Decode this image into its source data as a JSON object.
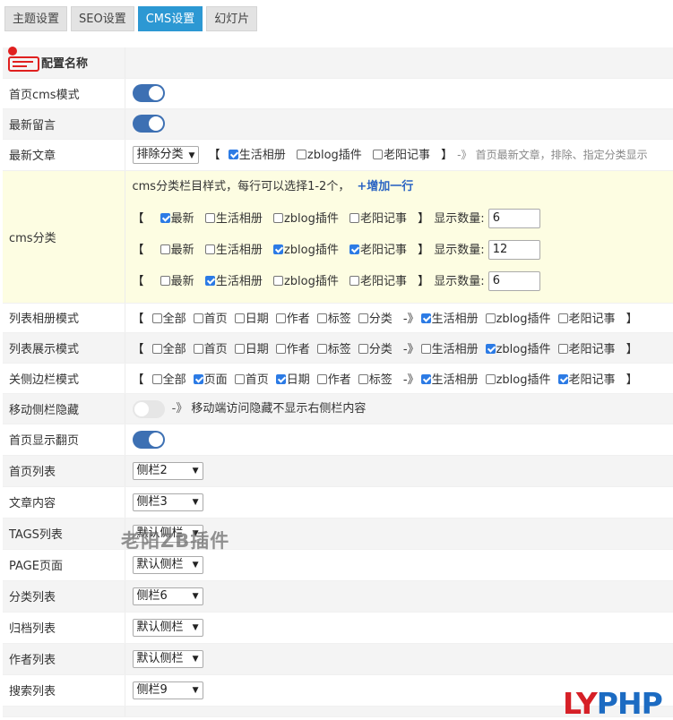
{
  "tabs": [
    {
      "label": "主题设置",
      "active": false
    },
    {
      "label": "SEO设置",
      "active": false
    },
    {
      "label": "CMS设置",
      "active": true
    },
    {
      "label": "幻灯片",
      "active": false
    }
  ],
  "header": {
    "label": "配置名称"
  },
  "rows": {
    "home_cms": {
      "label": "首页cms模式",
      "on": true
    },
    "latest_comments": {
      "label": "最新留言",
      "on": true
    },
    "latest_posts": {
      "label": "最新文章",
      "select": "排除分类",
      "options": [
        {
          "label": "生活相册",
          "checked": true
        },
        {
          "label": "zblog插件",
          "checked": false
        },
        {
          "label": "老阳记事",
          "checked": false
        }
      ],
      "hint": "首页最新文章，排除、指定分类显示"
    },
    "cms_category": {
      "label": "cms分类",
      "intro": "cms分类栏目样式，每行可以选择1-2个，",
      "add_row": "+增加一行",
      "count_label": "显示数量:",
      "lines": [
        {
          "options": [
            {
              "label": "最新",
              "checked": true
            },
            {
              "label": "生活相册",
              "checked": false
            },
            {
              "label": "zblog插件",
              "checked": false
            },
            {
              "label": "老阳记事",
              "checked": false
            }
          ],
          "count": "6"
        },
        {
          "options": [
            {
              "label": "最新",
              "checked": false
            },
            {
              "label": "生活相册",
              "checked": false
            },
            {
              "label": "zblog插件",
              "checked": true
            },
            {
              "label": "老阳记事",
              "checked": true
            }
          ],
          "count": "12"
        },
        {
          "options": [
            {
              "label": "最新",
              "checked": false
            },
            {
              "label": "生活相册",
              "checked": true
            },
            {
              "label": "zblog插件",
              "checked": false
            },
            {
              "label": "老阳记事",
              "checked": false
            }
          ],
          "count": "6"
        }
      ]
    },
    "list_album": {
      "label": "列表相册模式",
      "pages": [
        {
          "label": "全部",
          "checked": false
        },
        {
          "label": "首页",
          "checked": false
        },
        {
          "label": "日期",
          "checked": false
        },
        {
          "label": "作者",
          "checked": false
        },
        {
          "label": "标签",
          "checked": false
        },
        {
          "label": "分类",
          "checked": false
        }
      ],
      "cats": [
        {
          "label": "生活相册",
          "checked": true
        },
        {
          "label": "zblog插件",
          "checked": false
        },
        {
          "label": "老阳记事",
          "checked": false
        }
      ]
    },
    "list_display": {
      "label": "列表展示模式",
      "pages": [
        {
          "label": "全部",
          "checked": false
        },
        {
          "label": "首页",
          "checked": false
        },
        {
          "label": "日期",
          "checked": false
        },
        {
          "label": "作者",
          "checked": false
        },
        {
          "label": "标签",
          "checked": false
        },
        {
          "label": "分类",
          "checked": false
        }
      ],
      "cats": [
        {
          "label": "生活相册",
          "checked": false
        },
        {
          "label": "zblog插件",
          "checked": true
        },
        {
          "label": "老阳记事",
          "checked": false
        }
      ]
    },
    "close_sidebar": {
      "label": "关侧边栏模式",
      "pages": [
        {
          "label": "全部",
          "checked": false
        },
        {
          "label": "页面",
          "checked": true
        },
        {
          "label": "首页",
          "checked": false
        },
        {
          "label": "日期",
          "checked": true
        },
        {
          "label": "作者",
          "checked": false
        },
        {
          "label": "标签",
          "checked": false
        }
      ],
      "cats": [
        {
          "label": "生活相册",
          "checked": true
        },
        {
          "label": "zblog插件",
          "checked": false
        },
        {
          "label": "老阳记事",
          "checked": true
        }
      ]
    },
    "mobile_sidebar": {
      "label": "移动侧栏隐藏",
      "on": false,
      "hint": "移动端访问隐藏不显示右侧栏内容"
    },
    "home_paging": {
      "label": "首页显示翻页",
      "on": true
    },
    "home_list": {
      "label": "首页列表",
      "select": "侧栏2"
    },
    "article": {
      "label": "文章内容",
      "select": "侧栏3"
    },
    "tags_list": {
      "label": "TAGS列表",
      "select": "默认侧栏"
    },
    "page": {
      "label": "PAGE页面",
      "select": "默认侧栏"
    },
    "category_list": {
      "label": "分类列表",
      "select": "侧栏6"
    },
    "archive_list": {
      "label": "归档列表",
      "select": "默认侧栏"
    },
    "author_list": {
      "label": "作者列表",
      "select": "默认侧栏"
    },
    "search_list": {
      "label": "搜索列表",
      "select": "侧栏9"
    }
  },
  "symbols": {
    "bracket_open": "【",
    "bracket_close": "】",
    "arrow": "-》"
  },
  "watermark": "老阳ZB插件",
  "brand": {
    "part1": "LY",
    "part2": "PHP"
  },
  "colors": {
    "tab_active": "#2c98d3",
    "toggle_on": "#3d70b3",
    "checkbox": "#2c7be5",
    "highlight_row": "#fdfde2"
  }
}
